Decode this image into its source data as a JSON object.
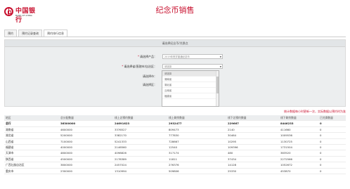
{
  "header": {
    "logo_cn": "中国银行",
    "logo_en": "BANK OF CHINA",
    "title": "纪念币销售"
  },
  "tabs": [
    {
      "label": "预约",
      "active": false
    },
    {
      "label": "预约记录查询",
      "active": false
    },
    {
      "label": "预约排行信息",
      "active": true
    }
  ],
  "form": {
    "title": "请选择纪念币/兑换点",
    "product_label": "请选择产品：",
    "product_value": "2019年贺岁普通纪念币",
    "province_label": "请选择省/直辖市/自治区：",
    "province_value": "请选择",
    "city_label": "请选择市：",
    "district_label": "请选择区："
  },
  "dropdown": {
    "items": [
      "请选择",
      "湖南省",
      "湖北省",
      "云南省",
      "福建省"
    ],
    "selected_index": 0
  },
  "note": "统计数据每小时更新一次，实际数据以预约时为准",
  "table": {
    "headers": [
      "地区",
      "总分配数量",
      "线上总预约数量",
      "线上剩余数量",
      "线下总预约数量",
      "线下剩余数量",
      "已兑换数量"
    ],
    "total": [
      "总行",
      "36300000",
      "24691623",
      "2932477",
      "229667",
      "8446233",
      "0"
    ],
    "rows": [
      [
        "湖南省",
        "4600000",
        "3376527",
        "809473",
        "2140",
        "411660",
        "0"
      ],
      [
        "湖北省",
        "5200000",
        "3382170",
        "777830",
        "30464",
        "1009536",
        "0"
      ],
      [
        "山西省",
        "7100000",
        "5241333",
        "728667",
        "10295",
        "1130725",
        "0"
      ],
      [
        "福建省",
        "4000000",
        "2146560",
        "12540",
        "109396",
        "1731504",
        "0"
      ],
      [
        "天津市",
        "4800000",
        "4098826",
        "317174",
        "480",
        "383520",
        "0"
      ],
      [
        "陕西省",
        "4500000",
        "2178389",
        "11811",
        "37434",
        "2272566",
        "0"
      ],
      [
        "广西壮族自治区",
        "3800000",
        "2457024",
        "276376",
        "14128",
        "1052672",
        "0"
      ],
      [
        "重庆市",
        "2300000",
        "1310994",
        "509806",
        "25330",
        "453870",
        "0"
      ]
    ]
  }
}
